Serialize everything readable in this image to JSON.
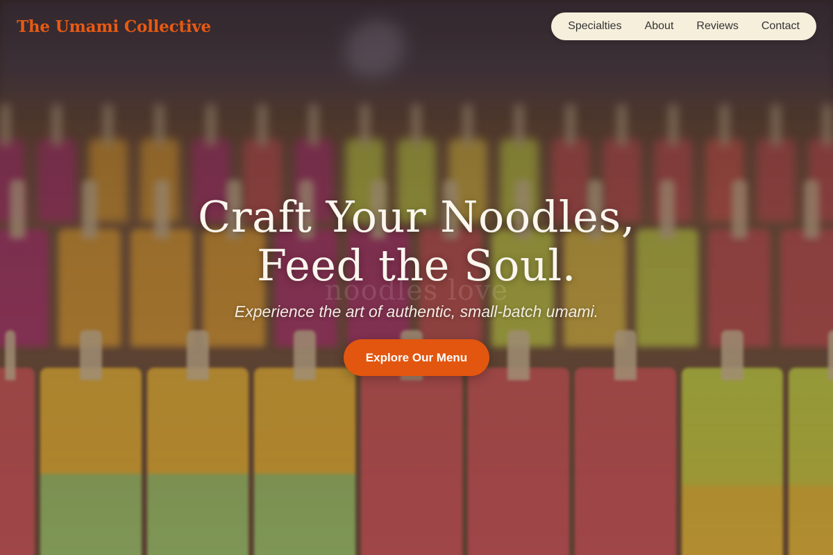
{
  "brand": {
    "name": "The Umami Collective",
    "color": "#e85a12"
  },
  "nav": {
    "items": [
      {
        "label": "Specialties"
      },
      {
        "label": "About"
      },
      {
        "label": "Reviews"
      },
      {
        "label": "Contact"
      }
    ]
  },
  "hero": {
    "title_line1": "Craft Your Noodles,",
    "title_line2": "Feed the Soul.",
    "watermark": "noodles love",
    "subtitle": "Experience the art of authentic, small-batch umami.",
    "cta_label": "Explore Our Menu",
    "cta_color": "#e2560f",
    "background_image": "blurred-popsicle-display-photo"
  }
}
